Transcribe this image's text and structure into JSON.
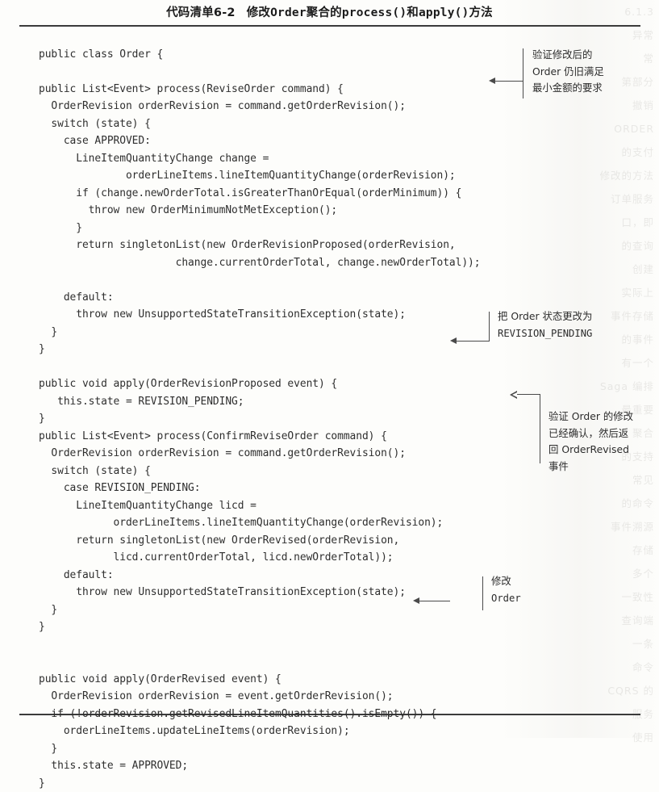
{
  "caption": {
    "number": "代码清单6-2",
    "title_pre": "修改",
    "title_mono1": "Order",
    "title_mid": "聚合的",
    "title_mono2": "process()",
    "title_and": "和",
    "title_mono3": "apply()",
    "title_post": "方法",
    "full": "代码清单6-2　修改Order聚合的process()和apply()方法"
  },
  "listing": {
    "language": "java",
    "lines": [
      "public class Order {",
      "",
      "public List<Event> process(ReviseOrder command) {",
      "  OrderRevision orderRevision = command.getOrderRevision();",
      "  switch (state) {",
      "    case APPROVED:",
      "      LineItemQuantityChange change =",
      "              orderLineItems.lineItemQuantityChange(orderRevision);",
      "      if (change.newOrderTotal.isGreaterThanOrEqual(orderMinimum)) {",
      "        throw new OrderMinimumNotMetException();",
      "      }",
      "      return singletonList(new OrderRevisionProposed(orderRevision,",
      "                      change.currentOrderTotal, change.newOrderTotal));",
      "",
      "    default:",
      "      throw new UnsupportedStateTransitionException(state);",
      "  }",
      "}",
      "",
      "public void apply(OrderRevisionProposed event) {",
      "   this.state = REVISION_PENDING;",
      "}",
      "public List<Event> process(ConfirmReviseOrder command) {",
      "  OrderRevision orderRevision = command.getOrderRevision();",
      "  switch (state) {",
      "    case REVISION_PENDING:",
      "      LineItemQuantityChange licd =",
      "            orderLineItems.lineItemQuantityChange(orderRevision);",
      "      return singletonList(new OrderRevised(orderRevision,",
      "            licd.currentOrderTotal, licd.newOrderTotal));",
      "    default:",
      "      throw new UnsupportedStateTransitionException(state);",
      "  }",
      "}",
      "",
      "",
      "public void apply(OrderRevised event) {",
      "  OrderRevision orderRevision = event.getOrderRevision();",
      "  if (!orderRevision.getRevisedLineItemQuantities().isEmpty()) {",
      "    orderLineItems.updateLineItems(orderRevision);",
      "  }",
      "  this.state = APPROVED;",
      "}"
    ]
  },
  "annotations": [
    {
      "id": "validate-minimum",
      "text": "验证修改后的\nOrder 仍旧满足\n最小金额的要求"
    },
    {
      "id": "set-revision-pending",
      "line1": "把 Order 状态更改为",
      "line2": "REVISION_PENDING"
    },
    {
      "id": "confirm-revision",
      "text": "验证 Order 的修改\n已经确认，然后返\n回 OrderRevised\n事件"
    },
    {
      "id": "modify-order",
      "line1": "修改",
      "line2": "Order"
    }
  ],
  "bleed_through": {
    "text": "6.1.3\n异常\n常\n第部分\n撤销\nORDER\n的支付\n修改的方法\n订单服务\n口，即\n的查询\n创建\n实际上\n事件存储\n的事件\n有一个\nSaga 编排\n最重要\n聚合\n的支持\n常见\n的命令\n事件溯源\n存储\n多个\n一致性\n查询端\n一条\n命令\nCQRS 的\n服务\n使用"
  },
  "colors": {
    "page_bg": "#fdfdfb",
    "ink": "#2e2e2e",
    "rule": "#3b3b3b",
    "annotation_ink": "#2c2c2c"
  }
}
